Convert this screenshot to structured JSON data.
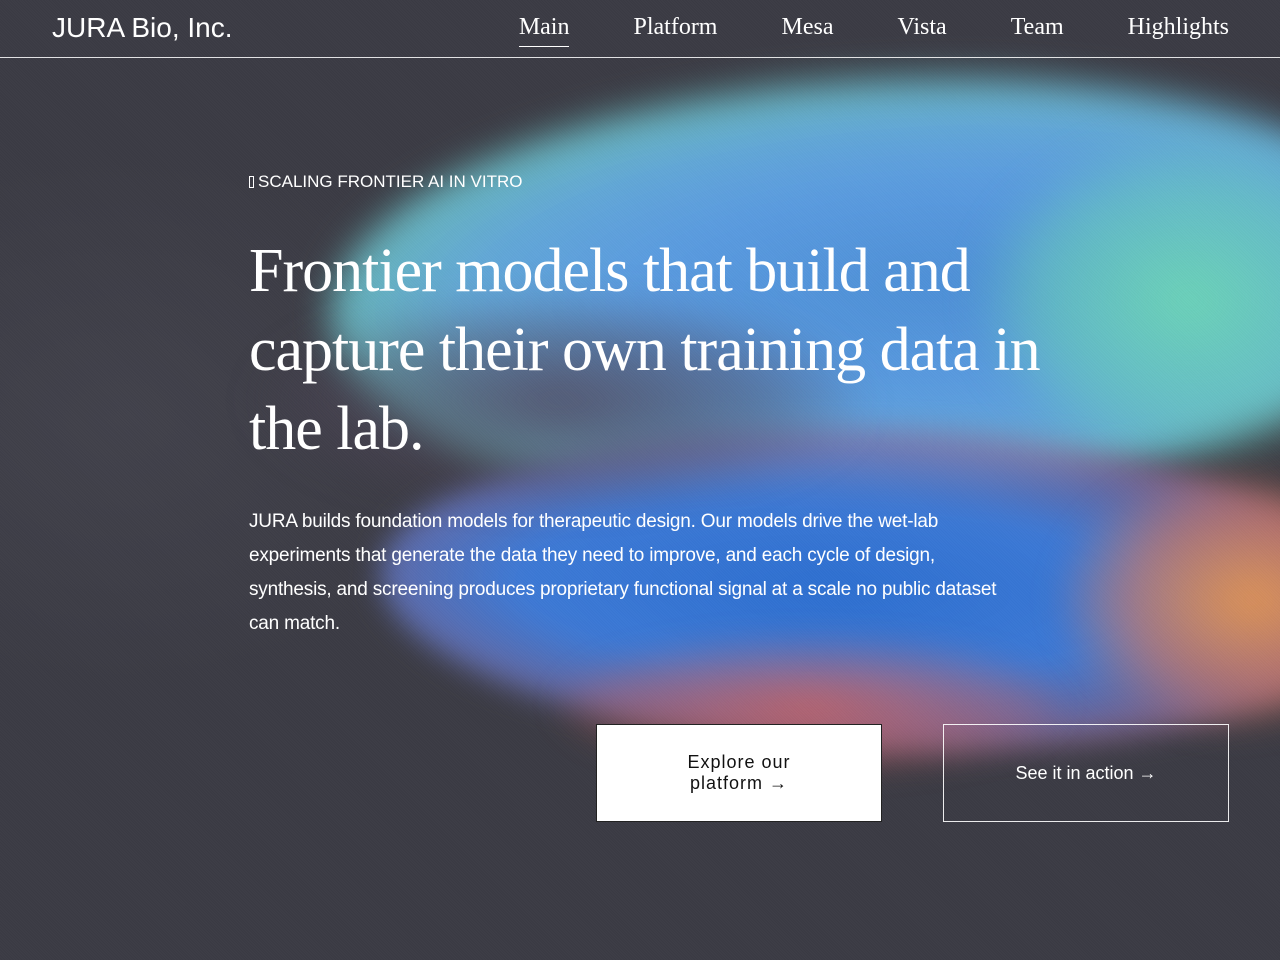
{
  "header": {
    "brand": "JURA Bio, Inc.",
    "nav": [
      {
        "label": "Main",
        "active": true
      },
      {
        "label": "Platform",
        "active": false
      },
      {
        "label": "Mesa",
        "active": false
      },
      {
        "label": "Vista",
        "active": false
      },
      {
        "label": "Team",
        "active": false
      },
      {
        "label": "Highlights",
        "active": false
      }
    ]
  },
  "hero": {
    "eyebrow": "SCALING FRONTIER AI IN VITRO",
    "headline": "Frontier models that build and capture their own training data in the lab.",
    "lede": "JURA builds foundation models for therapeutic design. Our models drive the wet-lab experiments that generate the data they need to improve, and each cycle of design, synthesis, and screening produces proprietary functional signal at a scale no public dataset can match.",
    "primary_cta": "Explore our platform →",
    "secondary_cta": "See it in action →"
  },
  "colors": {
    "background": "#3b3b44",
    "blob_blue": "#4d8fd6",
    "blob_mint": "#6ed7b4",
    "blob_orange": "#e69650",
    "text": "#ffffff"
  }
}
